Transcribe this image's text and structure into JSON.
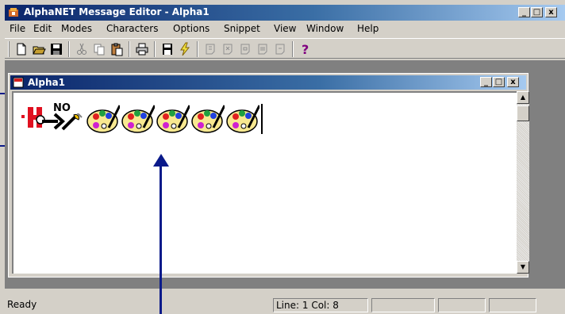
{
  "window": {
    "title": "AlphaNET Message Editor - Alpha1",
    "controls": {
      "minimize": "_",
      "maximize": "□",
      "close": "x"
    }
  },
  "menu": [
    "File",
    "Edit",
    "Modes",
    "Characters",
    "Options",
    "Snippet",
    "View",
    "Window",
    "Help"
  ],
  "toolbar": {
    "icons": [
      "new-file-icon",
      "open-folder-icon",
      "save-disk-icon",
      "cut-icon",
      "copy-icon",
      "paste-icon",
      "print-icon",
      "save-message-icon",
      "send-lightning-icon",
      "format-icon-1",
      "format-icon-2",
      "format-icon-3",
      "format-icon-4",
      "format-icon-5",
      "help-question-icon"
    ]
  },
  "child_window": {
    "title": "Alpha1",
    "controls": {
      "minimize": "_",
      "maximize": "□",
      "close": "x"
    }
  },
  "editor": {
    "content_icons": [
      "red-marker-icon",
      "hold-icon",
      "arrow-icon",
      "no-paint-icon",
      "palette-icon",
      "palette-icon",
      "palette-icon",
      "palette-icon",
      "palette-icon"
    ],
    "content_label_no": "NO"
  },
  "statusbar": {
    "state": "Ready",
    "position": "Line: 1  Col: 8"
  },
  "colors": {
    "title_active": "#0a246a",
    "window_face": "#d4d0c8",
    "annotation_arrow": "#0a1a8a"
  }
}
